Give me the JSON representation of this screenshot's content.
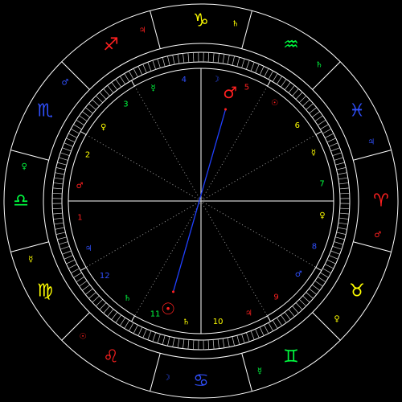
{
  "wheel": {
    "signs": [
      {
        "name": "aries",
        "glyph": "♈",
        "color": "#ff2020",
        "ruler": "♂",
        "ruler_color": "#ff2020",
        "lon": 15
      },
      {
        "name": "taurus",
        "glyph": "♉",
        "color": "#ffff00",
        "ruler": "♀",
        "ruler_color": "#ffff00",
        "lon": 45
      },
      {
        "name": "gemini",
        "glyph": "♊",
        "color": "#00ff40",
        "ruler": "☿",
        "ruler_color": "#00ff40",
        "lon": 75
      },
      {
        "name": "cancer",
        "glyph": "♋",
        "color": "#3050ff",
        "ruler": "☽",
        "ruler_color": "#3050ff",
        "lon": 105
      },
      {
        "name": "leo",
        "glyph": "♌",
        "color": "#ff2020",
        "ruler": "☉",
        "ruler_color": "#ff2020",
        "lon": 135
      },
      {
        "name": "virgo",
        "glyph": "♍",
        "color": "#ffff00",
        "ruler": "☿",
        "ruler_color": "#ffff00",
        "lon": 165
      },
      {
        "name": "libra",
        "glyph": "♎",
        "color": "#00ff40",
        "ruler": "♀",
        "ruler_color": "#00ff40",
        "lon": 195
      },
      {
        "name": "scorpio",
        "glyph": "♏",
        "color": "#3050ff",
        "ruler": "♂",
        "ruler_color": "#3050ff",
        "lon": 225
      },
      {
        "name": "sagittarius",
        "glyph": "♐",
        "color": "#ff2020",
        "ruler": "♃",
        "ruler_color": "#ff2020",
        "lon": 255
      },
      {
        "name": "capricorn",
        "glyph": "♑",
        "color": "#ffff00",
        "ruler": "♄",
        "ruler_color": "#ffff00",
        "lon": 285
      },
      {
        "name": "aquarius",
        "glyph": "♒",
        "color": "#00ff40",
        "ruler": "♄",
        "ruler_color": "#00ff40",
        "lon": 315
      },
      {
        "name": "pisces",
        "glyph": "♓",
        "color": "#3050ff",
        "ruler": "♃",
        "ruler_color": "#3050ff",
        "lon": 345
      }
    ],
    "houses": [
      {
        "num": "1",
        "color": "#ff2020",
        "ruler": "♂",
        "ruler_color": "#ff2020",
        "lon": 195
      },
      {
        "num": "2",
        "color": "#ffff00",
        "ruler": "♀",
        "ruler_color": "#ffff00",
        "lon": 225
      },
      {
        "num": "3",
        "color": "#00ff40",
        "ruler": "☿",
        "ruler_color": "#00ff40",
        "lon": 255
      },
      {
        "num": "4",
        "color": "#3050ff",
        "ruler": "☽",
        "ruler_color": "#3050ff",
        "lon": 285
      },
      {
        "num": "5",
        "color": "#ff2020",
        "ruler": "☉",
        "ruler_color": "#ff2020",
        "lon": 315
      },
      {
        "num": "6",
        "color": "#ffff00",
        "ruler": "☿",
        "ruler_color": "#ffff00",
        "lon": 345
      },
      {
        "num": "7",
        "color": "#00ff40",
        "ruler": "♀",
        "ruler_color": "#ffff00",
        "lon": 15
      },
      {
        "num": "8",
        "color": "#3050ff",
        "ruler": "♂",
        "ruler_color": "#3050ff",
        "lon": 45
      },
      {
        "num": "9",
        "color": "#ff2020",
        "ruler": "♃",
        "ruler_color": "#ff2020",
        "lon": 75
      },
      {
        "num": "10",
        "color": "#ffff00",
        "ruler": "♄",
        "ruler_color": "#ffff00",
        "lon": 105
      },
      {
        "num": "11",
        "color": "#00ff40",
        "ruler": "♄",
        "ruler_color": "#00ff40",
        "lon": 135
      },
      {
        "num": "12",
        "color": "#3050ff",
        "ruler": "♃",
        "ruler_color": "#3050ff",
        "lon": 165
      }
    ],
    "planets": [
      {
        "name": "sun",
        "glyph": "☉",
        "color": "#ff2020",
        "lon": 122
      },
      {
        "name": "mars",
        "glyph": "♂",
        "color": "#ff2020",
        "lon": 300
      }
    ],
    "aspect": {
      "from": "sun",
      "to": "mars",
      "color": "#2040ff"
    }
  }
}
